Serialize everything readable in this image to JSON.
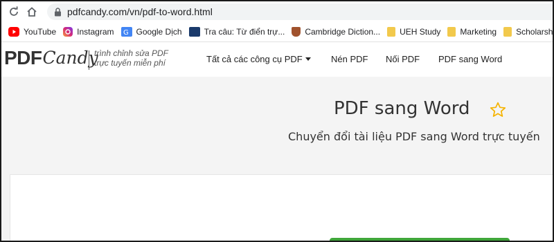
{
  "browser": {
    "url": "pdfcandy.com/vn/pdf-to-word.html",
    "bookmarks": [
      {
        "label": "YouTube",
        "icon": "youtube-icon",
        "color": "#ff0000"
      },
      {
        "label": "Instagram",
        "icon": "instagram-icon",
        "color": "#c13584"
      },
      {
        "label": "Google Dịch",
        "icon": "google-translate-icon",
        "color": "#4285f4"
      },
      {
        "label": "Tra câu: Từ điển trự...",
        "icon": "dictionary-icon",
        "color": "#1a3a6b"
      },
      {
        "label": "Cambridge Diction...",
        "icon": "cambridge-icon",
        "color": "#a0522d"
      },
      {
        "label": "UEH Study",
        "icon": "folder-icon",
        "color": "#f2c94c"
      },
      {
        "label": "Marketing",
        "icon": "folder-icon",
        "color": "#f2c94c"
      },
      {
        "label": "Scholarship",
        "icon": "folder-icon",
        "color": "#f2c94c"
      }
    ]
  },
  "site": {
    "logo_pdf": "PDF",
    "logo_candy": "Candy",
    "tagline_line1": "trình chỉnh sửa PDF",
    "tagline_line2": "trực tuyến miễn phí",
    "nav": {
      "all_tools": "Tất cả các công cụ PDF",
      "compress": "Nén PDF",
      "merge": "Nối PDF",
      "pdf_to_word": "PDF sang Word"
    }
  },
  "hero": {
    "title": "PDF sang Word",
    "subtitle": "Chuyển đổi tài liệu PDF sang Word trực tuyến"
  },
  "colors": {
    "accent_green": "#3fa63a",
    "star": "#f5b301"
  }
}
